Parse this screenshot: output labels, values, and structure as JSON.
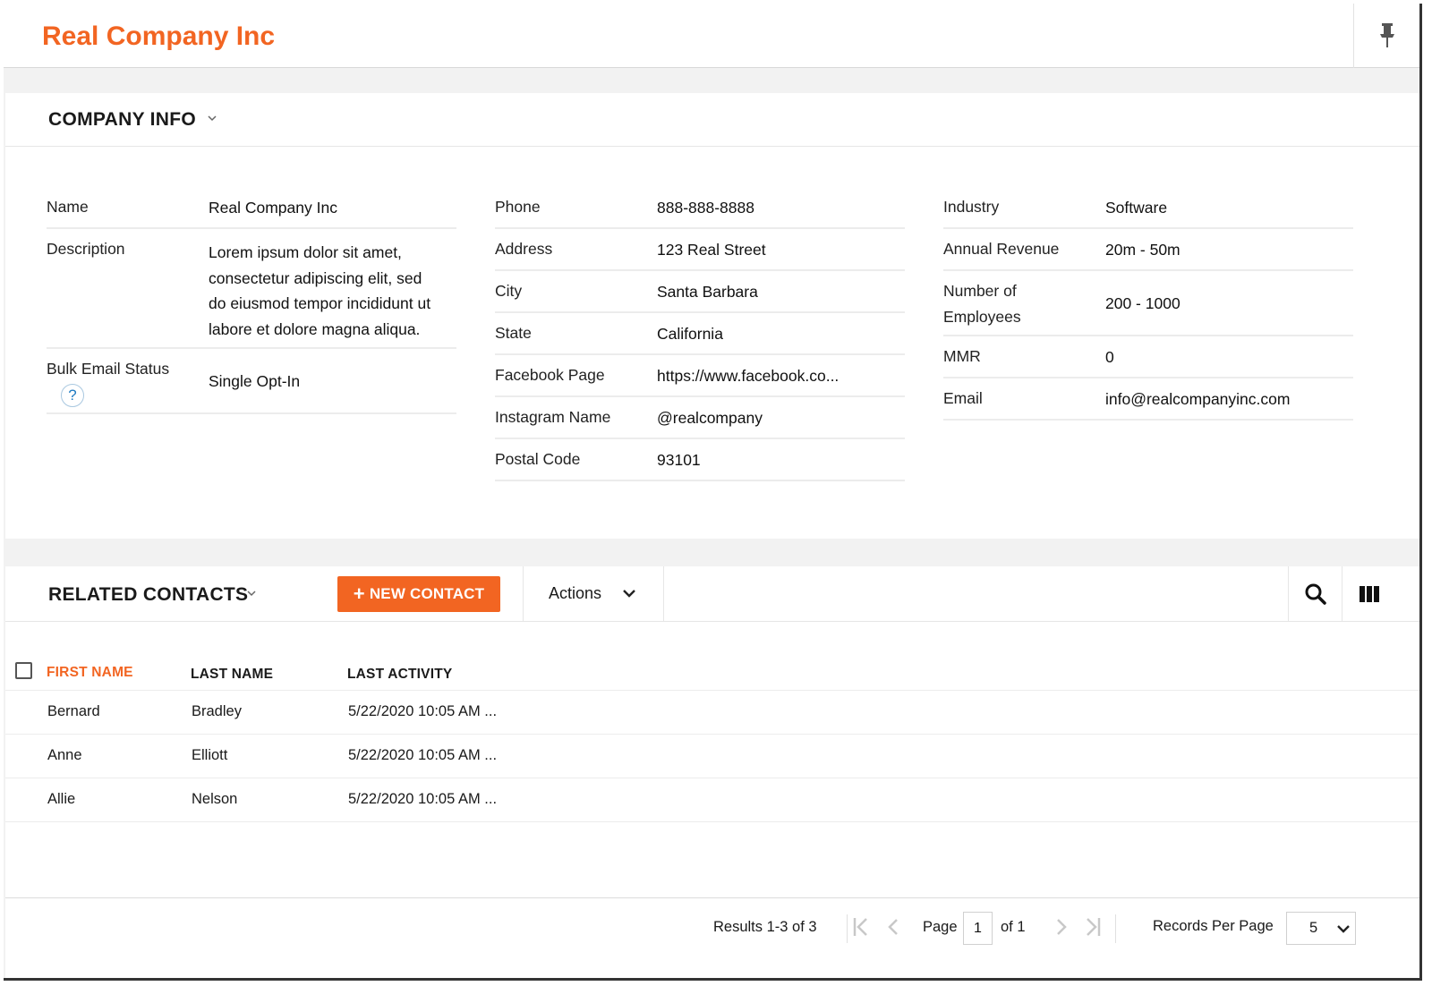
{
  "header": {
    "title": "Real Company Inc",
    "icon": "pin-icon"
  },
  "company_info": {
    "title": "COMPANY INFO",
    "col1": [
      {
        "label": "Name",
        "value": "Real Company Inc"
      },
      {
        "label": "Description",
        "value": "Lorem ipsum dolor sit amet, consectetur adipiscing elit, sed do eiusmod tempor incididunt ut labore et dolore magna aliqua."
      },
      {
        "label": "Bulk Email Status",
        "value": "Single Opt-In",
        "help": "?"
      }
    ],
    "col2": [
      {
        "label": "Phone",
        "value": "888-888-8888"
      },
      {
        "label": "Address",
        "value": "123 Real Street"
      },
      {
        "label": "City",
        "value": "Santa Barbara"
      },
      {
        "label": "State",
        "value": "California"
      },
      {
        "label": "Facebook Page",
        "value": "https://www.facebook.co..."
      },
      {
        "label": "Instagram Name",
        "value": "@realcompany"
      },
      {
        "label": "Postal Code",
        "value": "93101"
      }
    ],
    "col3": [
      {
        "label": "Industry",
        "value": "Software"
      },
      {
        "label": "Annual Revenue",
        "value": "20m - 50m"
      },
      {
        "label": "Number of Employees",
        "value": "200 - 1000"
      },
      {
        "label": "MMR",
        "value": "0"
      },
      {
        "label": "Email",
        "value": "info@realcompanyinc.com"
      }
    ]
  },
  "related_contacts": {
    "title": "RELATED CONTACTS",
    "new_button": "NEW CONTACT",
    "new_button_prefix": "+",
    "actions_label": "Actions",
    "columns": [
      "FIRST NAME",
      "LAST NAME",
      "LAST ACTIVITY"
    ],
    "rows": [
      {
        "first": "Bernard",
        "last": "Bradley",
        "activity": "5/22/2020 10:05 AM ..."
      },
      {
        "first": "Anne",
        "last": "Elliott",
        "activity": "5/22/2020 10:05 AM ..."
      },
      {
        "first": "Allie",
        "last": "Nelson",
        "activity": "5/22/2020 10:05 AM ..."
      }
    ]
  },
  "pagination": {
    "results": "Results 1-3 of 3",
    "page_label": "Page",
    "page_value": "1",
    "of_label": "of 1",
    "records_per_page_label": "Records Per Page",
    "records_per_page_value": "5"
  },
  "colors": {
    "accent": "#f26522",
    "help_blue": "#1f7bc2"
  }
}
